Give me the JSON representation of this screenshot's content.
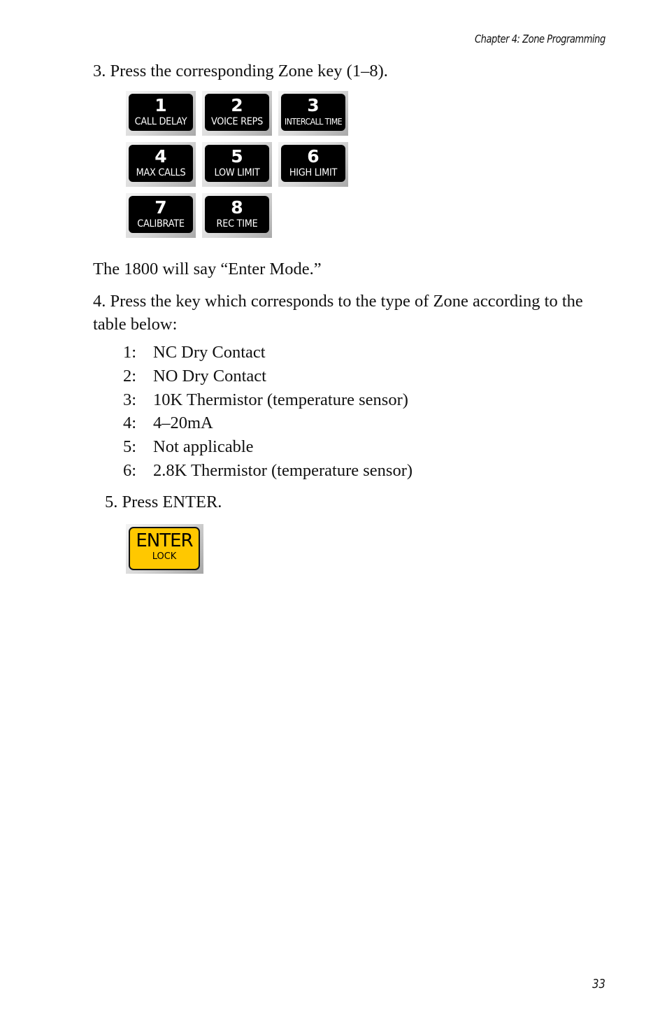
{
  "header": {
    "chapter": "Chapter 4: Zone Programming"
  },
  "steps": {
    "step3": "3. Press the corresponding Zone key (1–8).",
    "enter_mode_note": "The 1800 will say “Enter Mode.”",
    "step4": "4. Press the key which corresponds to the type of Zone according to the table below:",
    "step5": "5. Press ENTER."
  },
  "keypad": [
    {
      "number": "1",
      "label": "CALL DELAY"
    },
    {
      "number": "2",
      "label": "VOICE REPS"
    },
    {
      "number": "3",
      "label": "INTERCALL TIME"
    },
    {
      "number": "4",
      "label": "MAX CALLS"
    },
    {
      "number": "5",
      "label": "LOW LIMIT"
    },
    {
      "number": "6",
      "label": "HIGH LIMIT"
    },
    {
      "number": "7",
      "label": "CALIBRATE"
    },
    {
      "number": "8",
      "label": "REC TIME"
    }
  ],
  "zone_types": [
    {
      "key": "1:",
      "desc": "NC Dry Contact"
    },
    {
      "key": "2:",
      "desc": "NO Dry Contact"
    },
    {
      "key": "3:",
      "desc": "10K Thermistor (temperature sensor)"
    },
    {
      "key": "4:",
      "desc": "4–20mA"
    },
    {
      "key": "5:",
      "desc": "Not applicable"
    },
    {
      "key": "6:",
      "desc": "2.8K Thermistor (temperature sensor)"
    }
  ],
  "enter_key": {
    "label": "ENTER",
    "sublabel": "LOCK",
    "color": "#ffc800"
  },
  "footer": {
    "page_number": "33"
  }
}
